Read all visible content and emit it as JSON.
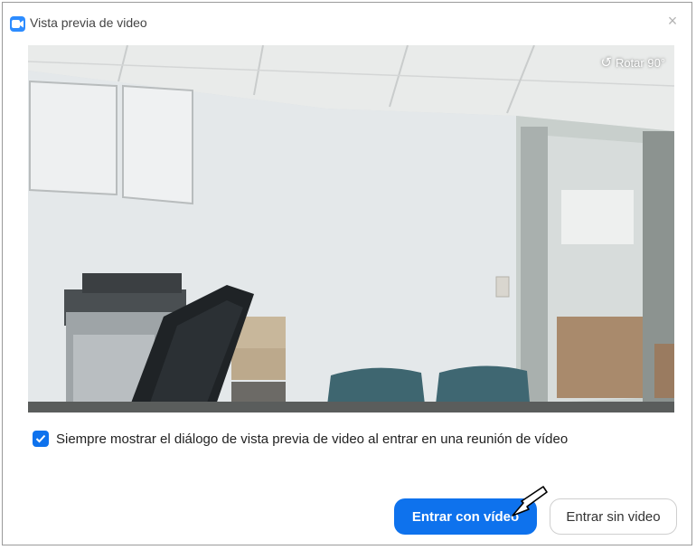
{
  "window": {
    "title": "Vista previa de video",
    "close_glyph": "×"
  },
  "video": {
    "rotate_label": "Rotar 90°"
  },
  "options": {
    "always_show_label": "Siempre mostrar el diálogo de vista previa de video al entrar en una reunión de vídeo",
    "always_show_checked": true
  },
  "actions": {
    "join_with_video": "Entrar con vídeo",
    "join_without_video": "Entrar sin video"
  },
  "colors": {
    "accent": "#0e72ed",
    "app_icon": "#2d8cff"
  },
  "icons": {
    "app": "video-camera-icon",
    "rotate": "rotate-ccw-icon",
    "check": "checkmark-icon",
    "close": "close-icon",
    "pointer": "arrow-cursor-icon"
  }
}
